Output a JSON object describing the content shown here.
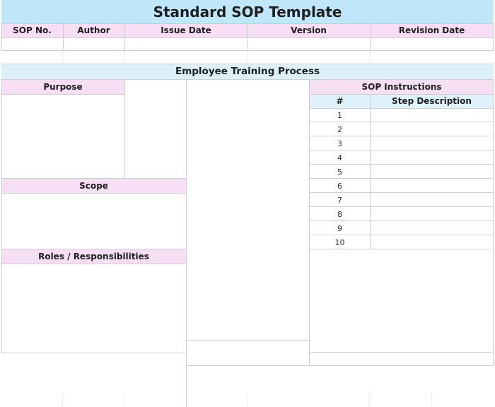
{
  "title": "Standard SOP Template",
  "meta_headers": {
    "sop_no": "SOP No.",
    "author": "Author",
    "issue_date": "Issue Date",
    "version": "Version",
    "revision_date": "Revision Date"
  },
  "process_title": "Employee Training Process",
  "sections": {
    "purpose": "Purpose",
    "scope": "Scope",
    "roles": "Roles / Responsibilities",
    "instructions": "SOP Instructions"
  },
  "instructions_table": {
    "col_number": "#",
    "col_description": "Step Description",
    "steps": [
      "1",
      "2",
      "3",
      "4",
      "5",
      "6",
      "7",
      "8",
      "9",
      "10"
    ]
  }
}
